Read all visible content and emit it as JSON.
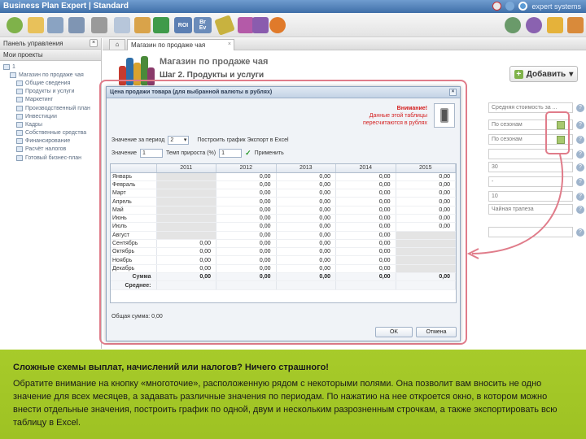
{
  "app": {
    "brand": "Business Plan Expert",
    "edition": "Standard",
    "company": "expert systems"
  },
  "colors": {
    "topbar": "#3f6fa8",
    "accent_green": "#a7cb2a",
    "annotation_red": "#e07c8a",
    "warning_red": "#d42020"
  },
  "left_panel": {
    "title": "Панель управления",
    "section": "Мои проекты",
    "close": "×",
    "tree": [
      {
        "label": "1",
        "indent": 0
      },
      {
        "label": "Магазин по продаже чая",
        "indent": 1
      },
      {
        "label": "Общие сведения",
        "indent": 2
      },
      {
        "label": "Продукты и услуги",
        "indent": 2
      },
      {
        "label": "Маркетинг",
        "indent": 2
      },
      {
        "label": "Производственный план",
        "indent": 2
      },
      {
        "label": "Инвестиции",
        "indent": 2
      },
      {
        "label": "Кадры",
        "indent": 2
      },
      {
        "label": "Собственные средства",
        "indent": 2
      },
      {
        "label": "Финансирование",
        "indent": 2
      },
      {
        "label": "Расчёт налогов",
        "indent": 2
      },
      {
        "label": "Готовый бизнес-план",
        "indent": 2
      }
    ]
  },
  "tabs": {
    "home_icon": "⌂",
    "active": "Магазин по продаже чая",
    "close": "×"
  },
  "header": {
    "title": "Магазин по продаже чая",
    "step": "Шаг 2. Продукты и услуги",
    "add_button": "Добавить",
    "add_plus": "+",
    "add_arrow": "▾"
  },
  "bg_fields": [
    {
      "value": "Средняя стоимость за ..."
    },
    {
      "value": "По сезонам"
    },
    {
      "value": "По сезонам"
    },
    {
      "value": ""
    },
    {
      "value": "30"
    },
    {
      "value": "-"
    },
    {
      "value": "10"
    },
    {
      "value": "Чайная трапеза"
    },
    {
      "value": ""
    }
  ],
  "dialog": {
    "title": "Цена продажи товара (для выбранной валюты в рублях)",
    "close": "×",
    "warning": {
      "line1": "Внимание!",
      "line2": "Данные этой таблицы",
      "line3": "пересчитаются в рублях"
    },
    "row1": {
      "label": "Значение за период",
      "period_value": "2",
      "chart_label": "Построить график  Экспорт в Excel"
    },
    "row2": {
      "label": "Значение",
      "value": "1",
      "growth_label": "Темп прироста (%)",
      "growth_value": "1",
      "apply_label": "Применить",
      "check": "✓"
    },
    "grid": {
      "years": [
        "2011",
        "2012",
        "2013",
        "2014",
        "2015"
      ],
      "rows": [
        {
          "month": "Январь",
          "v": [
            "",
            "0,00",
            "0,00",
            "0,00",
            "0,00"
          ]
        },
        {
          "month": "Февраль",
          "v": [
            "",
            "0,00",
            "0,00",
            "0,00",
            "0,00"
          ]
        },
        {
          "month": "Март",
          "v": [
            "",
            "0,00",
            "0,00",
            "0,00",
            "0,00"
          ]
        },
        {
          "month": "Апрель",
          "v": [
            "",
            "0,00",
            "0,00",
            "0,00",
            "0,00"
          ]
        },
        {
          "month": "Май",
          "v": [
            "",
            "0,00",
            "0,00",
            "0,00",
            "0,00"
          ]
        },
        {
          "month": "Июнь",
          "v": [
            "",
            "0,00",
            "0,00",
            "0,00",
            "0,00"
          ]
        },
        {
          "month": "Июль",
          "v": [
            "",
            "0,00",
            "0,00",
            "0,00",
            "0,00"
          ]
        },
        {
          "month": "Август",
          "v": [
            "",
            "0,00",
            "0,00",
            "0,00",
            ""
          ]
        },
        {
          "month": "Сентябрь",
          "v": [
            "0,00",
            "0,00",
            "0,00",
            "0,00",
            ""
          ]
        },
        {
          "month": "Октябрь",
          "v": [
            "0,00",
            "0,00",
            "0,00",
            "0,00",
            ""
          ]
        },
        {
          "month": "Ноябрь",
          "v": [
            "0,00",
            "0,00",
            "0,00",
            "0,00",
            ""
          ]
        },
        {
          "month": "Декабрь",
          "v": [
            "0,00",
            "0,00",
            "0,00",
            "0,00",
            ""
          ]
        }
      ],
      "sum_label": "Сумма",
      "sum_values": [
        "0,00",
        "0,00",
        "0,00",
        "0,00",
        "0,00"
      ],
      "avg_label": "Среднее:"
    },
    "total": "Общая сумма: 0,00",
    "ok": "OK",
    "cancel": "Отмена"
  },
  "description": {
    "heading": "Сложные схемы выплат, начислений или налогов? Ничего страшного!",
    "body": "Обратите внимание на кнопку «многоточие», расположенную рядом с некоторыми полями. Она позволит вам вносить не одно значение для всех месяцев, а задавать различные значения по периодам. По нажатию на нее откроется окно, в котором можно внести отдельные значения, построить график по одной, двум и нескольким разрозненным строчкам, а также экспортировать всю таблицу в Excel."
  }
}
